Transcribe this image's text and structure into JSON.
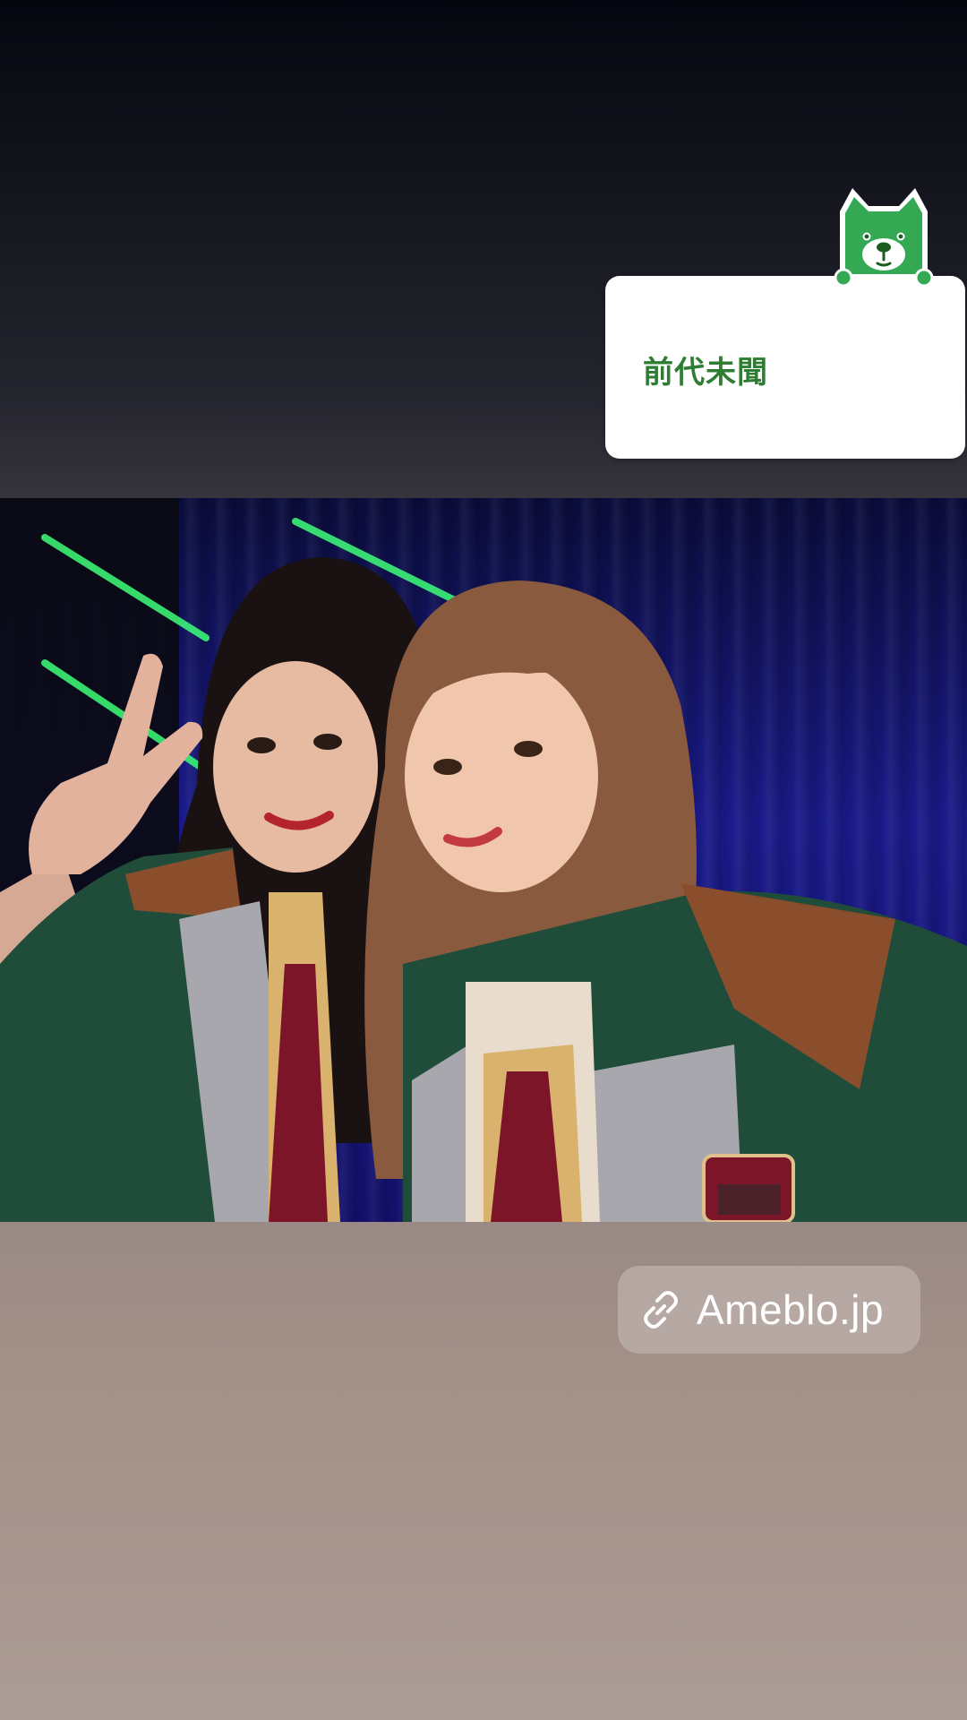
{
  "story": {
    "blog_card": {
      "title": "前代未聞",
      "mascot_icon": "ameba-dog-mascot-icon",
      "accent_color": "#2e7d32"
    },
    "photo": {
      "description_icon": "photo"
    },
    "link_sticker": {
      "icon": "link-icon",
      "label": "Ameblo.jp"
    }
  }
}
